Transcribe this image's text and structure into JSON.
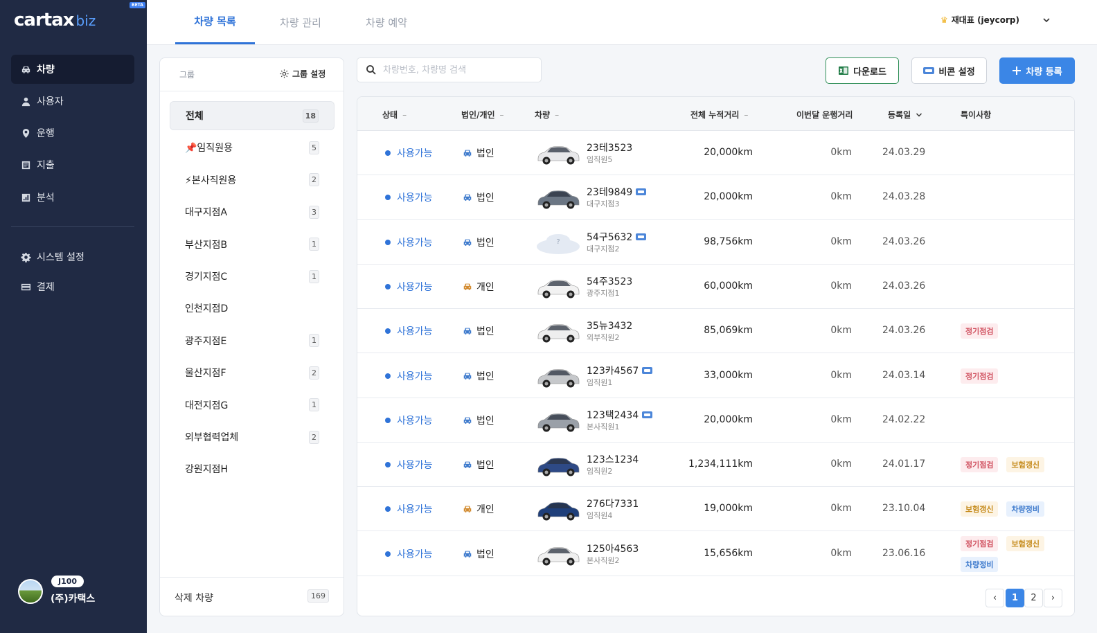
{
  "brand": {
    "name": "cartax",
    "suffix": "biz",
    "badge": "BETA"
  },
  "sidebar": {
    "items": [
      {
        "label": "차량",
        "icon": "car-icon"
      },
      {
        "label": "사용자",
        "icon": "user-icon"
      },
      {
        "label": "운행",
        "icon": "location-pin-icon"
      },
      {
        "label": "지출",
        "icon": "receipt-icon"
      },
      {
        "label": "분석",
        "icon": "chart-icon"
      }
    ],
    "settings": [
      {
        "label": "시스템 설정",
        "icon": "gear-icon"
      },
      {
        "label": "결제",
        "icon": "card-icon"
      }
    ],
    "account": {
      "plan": "J100",
      "company": "(주)카택스"
    }
  },
  "header": {
    "tabs": [
      "차량 목록",
      "차량 관리",
      "차량 예약"
    ],
    "user": "재대표 (jeycorp)"
  },
  "groups": {
    "label": "그룹",
    "settings_label": "그룹 설정",
    "items": [
      {
        "name": "전체",
        "count": "18"
      },
      {
        "name": "📌임직원용",
        "count": "5"
      },
      {
        "name": "⚡본사직원용",
        "count": "2"
      },
      {
        "name": "대구지점A",
        "count": "3"
      },
      {
        "name": "부산지점B",
        "count": "1"
      },
      {
        "name": "경기지점C",
        "count": "1"
      },
      {
        "name": "인천지점D",
        "count": ""
      },
      {
        "name": "광주지점E",
        "count": "1"
      },
      {
        "name": "울산지점F",
        "count": "2"
      },
      {
        "name": "대전지점G",
        "count": "1"
      },
      {
        "name": "외부협력업체",
        "count": "2"
      },
      {
        "name": "강원지점H",
        "count": ""
      }
    ],
    "deleted_label": "삭제 차량",
    "deleted_count": "169"
  },
  "toolbar": {
    "search_placeholder": "차량번호, 차량명 검색",
    "download": "다운로드",
    "beacon": "비콘 설정",
    "add": "차량 등록"
  },
  "table": {
    "headers": [
      "상태",
      "법인/개인",
      "차량",
      "전체 누적거리",
      "이번달 운행거리",
      "등록일",
      "특이사항"
    ],
    "rows": [
      {
        "status": "사용가능",
        "owner": "법인",
        "owner_color": "#3c79cc",
        "plate": "23테3523",
        "beacon": false,
        "driver": "임직원5",
        "total": "20,000km",
        "month": "0km",
        "date": "24.03.29",
        "tags": [],
        "car_color": "#e8e8ea"
      },
      {
        "status": "사용가능",
        "owner": "법인",
        "owner_color": "#3c79cc",
        "plate": "23테9849",
        "beacon": true,
        "driver": "대구지점3",
        "total": "20,000km",
        "month": "0km",
        "date": "24.03.28",
        "tags": [],
        "car_color": "#6b7684"
      },
      {
        "status": "사용가능",
        "owner": "법인",
        "owner_color": "#3c79cc",
        "plate": "54구5632",
        "beacon": true,
        "driver": "대구지점2",
        "total": "98,756km",
        "month": "0km",
        "date": "24.03.26",
        "tags": [],
        "car_color": "#e4eaf3"
      },
      {
        "status": "사용가능",
        "owner": "개인",
        "owner_color": "#d28a2e",
        "plate": "54주3523",
        "beacon": false,
        "driver": "광주지점1",
        "total": "60,000km",
        "month": "0km",
        "date": "24.03.26",
        "tags": [],
        "car_color": "#f2f2f2"
      },
      {
        "status": "사용가능",
        "owner": "법인",
        "owner_color": "#3c79cc",
        "plate": "35뉴3432",
        "beacon": false,
        "driver": "외부직원2",
        "total": "85,069km",
        "month": "0km",
        "date": "24.03.26",
        "tags": [
          "정기점검"
        ],
        "car_color": "#eeeeee"
      },
      {
        "status": "사용가능",
        "owner": "법인",
        "owner_color": "#3c79cc",
        "plate": "123카4567",
        "beacon": true,
        "driver": "임직원1",
        "total": "33,000km",
        "month": "0km",
        "date": "24.03.14",
        "tags": [
          "정기점검"
        ],
        "car_color": "#c6c8cb"
      },
      {
        "status": "사용가능",
        "owner": "법인",
        "owner_color": "#3c79cc",
        "plate": "123택2434",
        "beacon": true,
        "driver": "본사직원1",
        "total": "20,000km",
        "month": "0km",
        "date": "24.02.22",
        "tags": [],
        "car_color": "#9aa0a8"
      },
      {
        "status": "사용가능",
        "owner": "법인",
        "owner_color": "#3c79cc",
        "plate": "123스1234",
        "beacon": false,
        "driver": "임직원2",
        "total": "1,234,111km",
        "month": "0km",
        "date": "24.01.17",
        "tags": [
          "정기점검",
          "보험갱신"
        ],
        "car_color": "#2e4a86"
      },
      {
        "status": "사용가능",
        "owner": "개인",
        "owner_color": "#d28a2e",
        "plate": "276다7331",
        "beacon": false,
        "driver": "임직원4",
        "total": "19,000km",
        "month": "0km",
        "date": "23.10.04",
        "tags": [
          "보험갱신",
          "차량정비"
        ],
        "car_color": "#1f3f7a"
      },
      {
        "status": "사용가능",
        "owner": "법인",
        "owner_color": "#3c79cc",
        "plate": "125아4563",
        "beacon": false,
        "driver": "본사직원2",
        "total": "15,656km",
        "month": "0km",
        "date": "23.06.16",
        "tags": [
          "정기점검",
          "보험갱신",
          "차량정비"
        ],
        "car_color": "#f0f0f0"
      }
    ]
  },
  "tag_styles": {
    "정기점검": "t-red",
    "보험갱신": "t-orange",
    "차량정비": "t-blue"
  },
  "pagination": {
    "prev": "‹",
    "pages": [
      "1",
      "2"
    ],
    "current": "1",
    "next": "›"
  }
}
